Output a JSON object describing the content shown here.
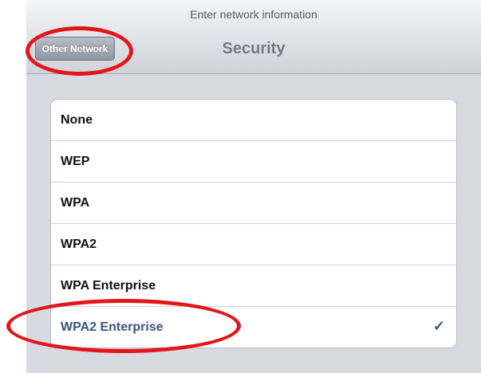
{
  "navbar": {
    "prompt": "Enter network information",
    "title": "Security",
    "back_label": "Other Network"
  },
  "security_options": [
    {
      "label": "None",
      "selected": false
    },
    {
      "label": "WEP",
      "selected": false
    },
    {
      "label": "WPA",
      "selected": false
    },
    {
      "label": "WPA2",
      "selected": false
    },
    {
      "label": "WPA Enterprise",
      "selected": false
    },
    {
      "label": "WPA2 Enterprise",
      "selected": true
    }
  ],
  "checkmark": "✓",
  "colors": {
    "selected_text": "#3a5487",
    "annotation": "#e4161b",
    "background": "#d7dae1"
  }
}
